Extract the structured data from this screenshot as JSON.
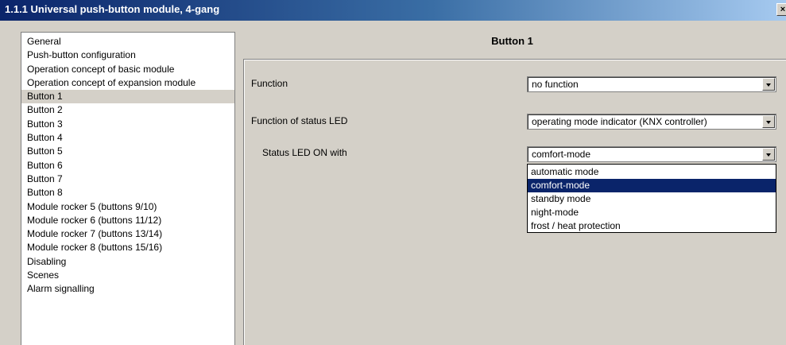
{
  "window": {
    "title": "1.1.1 Universal push-button module, 4-gang",
    "close_label": "×"
  },
  "sidebar": {
    "items": [
      {
        "label": "General"
      },
      {
        "label": "Push-button configuration"
      },
      {
        "label": "Operation concept of basic module"
      },
      {
        "label": "Operation concept of expansion module"
      },
      {
        "label": "Button 1",
        "selected": true
      },
      {
        "label": "Button 2"
      },
      {
        "label": "Button 3"
      },
      {
        "label": "Button 4"
      },
      {
        "label": "Button 5"
      },
      {
        "label": "Button 6"
      },
      {
        "label": "Button 7"
      },
      {
        "label": "Button 8"
      },
      {
        "label": "Module rocker 5 (buttons 9/10)"
      },
      {
        "label": "Module rocker 6 (buttons 11/12)"
      },
      {
        "label": "Module rocker 7 (buttons 13/14)"
      },
      {
        "label": "Module rocker 8 (buttons 15/16)"
      },
      {
        "label": "Disabling"
      },
      {
        "label": "Scenes"
      },
      {
        "label": "Alarm signalling"
      }
    ]
  },
  "panel": {
    "title": "Button 1",
    "params": [
      {
        "label": "Function",
        "value": "no function"
      },
      {
        "label": "Function of status LED",
        "value": "operating mode indicator (KNX controller)"
      },
      {
        "label": "Status LED ON with",
        "value": "comfort-mode"
      }
    ],
    "dropdown": {
      "options": [
        "automatic mode",
        "comfort-mode",
        "standby mode",
        "night-mode",
        "frost / heat protection"
      ],
      "selected_index": 1
    }
  },
  "colors": {
    "title_bar": "#0a246a",
    "selection": "#0a246a",
    "window_bg": "#d4d0c8"
  }
}
